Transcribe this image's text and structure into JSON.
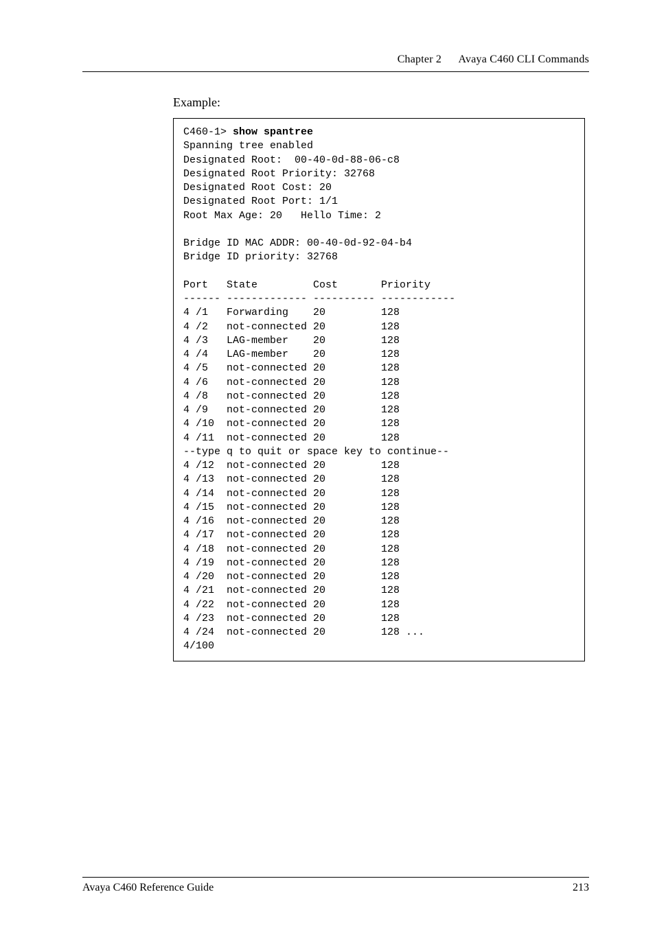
{
  "header": {
    "chapter": "Chapter 2",
    "title": "Avaya C460 CLI Commands"
  },
  "label_example": "Example:",
  "terminal": {
    "prompt": "C460-1> ",
    "command": "show spantree",
    "header_lines": [
      "Spanning tree enabled",
      "Designated Root:  00-40-0d-88-06-c8",
      "Designated Root Priority: 32768",
      "Designated Root Cost: 20",
      "Designated Root Port: 1/1",
      "Root Max Age: 20   Hello Time: 2",
      "",
      "Bridge ID MAC ADDR: 00-40-0d-92-04-b4",
      "Bridge ID priority: 32768",
      ""
    ],
    "col_header": "Port   State         Cost       Priority",
    "col_rule": "------ ------------- ---------- ------------",
    "rows_before": [
      "4 /1   Forwarding    20         128",
      "4 /2   not-connected 20         128",
      "4 /3   LAG-member    20         128",
      "4 /4   LAG-member    20         128",
      "4 /5   not-connected 20         128",
      "4 /6   not-connected 20         128",
      "4 /8   not-connected 20         128",
      "4 /9   not-connected 20         128",
      "4 /10  not-connected 20         128",
      "4 /11  not-connected 20         128"
    ],
    "continue_line": "--type q to quit or space key to continue--",
    "rows_after": [
      "4 /12  not-connected 20         128",
      "4 /13  not-connected 20         128",
      "4 /14  not-connected 20         128",
      "4 /15  not-connected 20         128",
      "4 /16  not-connected 20         128",
      "4 /17  not-connected 20         128",
      "4 /18  not-connected 20         128",
      "4 /19  not-connected 20         128",
      "4 /20  not-connected 20         128",
      "4 /21  not-connected 20         128",
      "4 /22  not-connected 20         128",
      "4 /23  not-connected 20         128",
      "4 /24  not-connected 20         128 ...",
      "4/100"
    ]
  },
  "footer": {
    "left": "Avaya C460 Reference Guide",
    "right": "213"
  }
}
